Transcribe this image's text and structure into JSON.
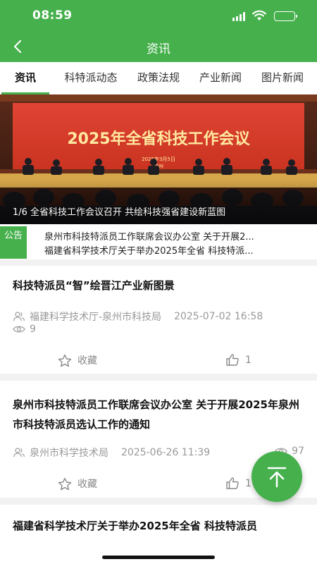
{
  "status_bar": {
    "time": "08:59"
  },
  "header": {
    "title": "资讯"
  },
  "tabs": [
    {
      "label": "资讯",
      "active": true
    },
    {
      "label": "科特派动态",
      "active": false
    },
    {
      "label": "政策法规",
      "active": false
    },
    {
      "label": "产业新闻",
      "active": false
    },
    {
      "label": "图片新闻",
      "active": false
    }
  ],
  "banner": {
    "headline": "2025年全省科技工作会议",
    "date_text": "2025年3月5日",
    "city_text": "福州",
    "caption": "1/6 全省科技工作会议召开 共绘科技强省建设新蓝图"
  },
  "notice": {
    "tag": "公告",
    "lines": [
      "泉州市科技特派员工作联席会议办公室 关于开展2...",
      "福建省科学技术厅关于举办2025年全省 科技特派..."
    ]
  },
  "articles": [
    {
      "title": "科技特派员“智”绘晋江产业新图景",
      "source": "福建科学技术厅-泉州市科技局",
      "datetime": "2025-07-02 16:58",
      "views": "9",
      "favorite_label": "收藏",
      "likes": "1"
    },
    {
      "title": "泉州市科技特派员工作联席会议办公室 关于开展2025年泉州市科技特派员选认工作的通知",
      "source": "泉州市科学技术局",
      "datetime": "2025-06-26 11:39",
      "views": "97",
      "favorite_label": "收藏",
      "likes": "1"
    },
    {
      "title": "福建省科学技术厅关于举办2025年全省 科技特派员"
    }
  ],
  "colors": {
    "brand": "#45b04c",
    "background": "#f2f2f2",
    "banner_red": "#d8392b"
  },
  "icons": {
    "back": "chevron-left-icon",
    "author": "users-icon",
    "views": "eye-icon",
    "favorite": "star-icon",
    "like": "thumbs-up-icon",
    "scroll_top": "arrow-up-to-top-icon"
  }
}
